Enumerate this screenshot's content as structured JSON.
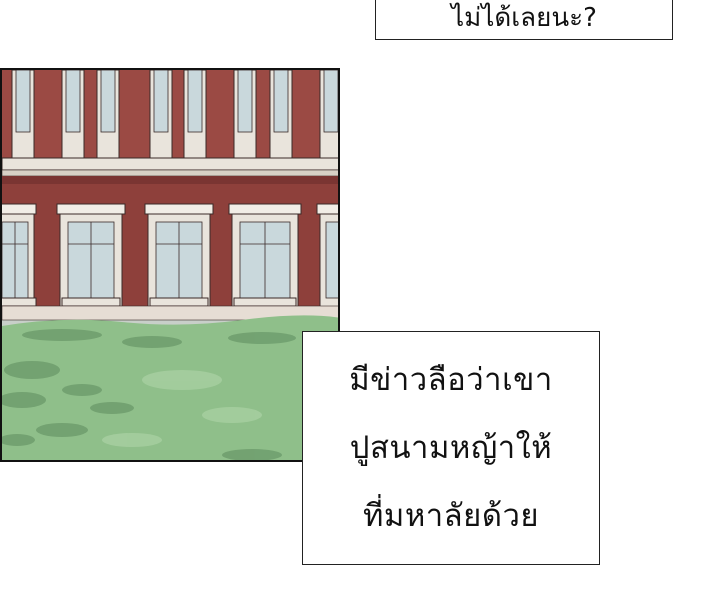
{
  "captions": {
    "top": "ไม่ได้เลยนะ?",
    "bottom_lines": [
      "มีข่าวลือว่าเขา",
      "ปูสนามหญ้าให้",
      "ที่มหาลัยด้วย"
    ]
  },
  "colors": {
    "brick": "#9b4a44",
    "brick_dark": "#7a3532",
    "trim": "#e9e4dc",
    "window_glass": "#c9d8dc",
    "grass": "#8fbf8a",
    "grass_shadow": "#6f9e6d"
  }
}
